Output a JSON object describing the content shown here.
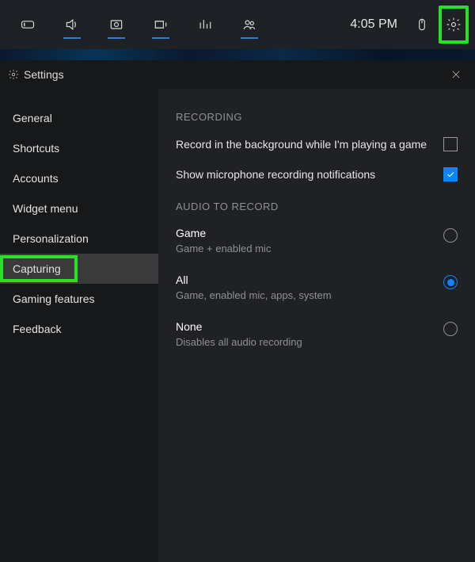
{
  "topbar": {
    "clock": "4:05 PM",
    "icons": {
      "xbox": "xbox-icon",
      "audio": "speaker-icon",
      "capture": "capture-icon",
      "broadcast": "broadcast-icon",
      "performance": "performance-icon",
      "social": "social-icon",
      "mouse": "mouse-icon",
      "settings": "gear-icon"
    }
  },
  "panel": {
    "title": "Settings"
  },
  "sidebar": {
    "items": [
      {
        "label": "General"
      },
      {
        "label": "Shortcuts"
      },
      {
        "label": "Accounts"
      },
      {
        "label": "Widget menu"
      },
      {
        "label": "Personalization"
      },
      {
        "label": "Capturing"
      },
      {
        "label": "Gaming features"
      },
      {
        "label": "Feedback"
      }
    ]
  },
  "content": {
    "recording_header": "RECORDING",
    "rows": [
      {
        "label": "Record in the background while I'm playing a game",
        "checked": false
      },
      {
        "label": "Show microphone recording notifications",
        "checked": true
      }
    ],
    "audio_header": "AUDIO TO RECORD",
    "options": [
      {
        "title": "Game",
        "sub": "Game + enabled mic",
        "selected": false
      },
      {
        "title": "All",
        "sub": "Game, enabled mic, apps, system",
        "selected": true
      },
      {
        "title": "None",
        "sub": "Disables all audio recording",
        "selected": false
      }
    ]
  }
}
